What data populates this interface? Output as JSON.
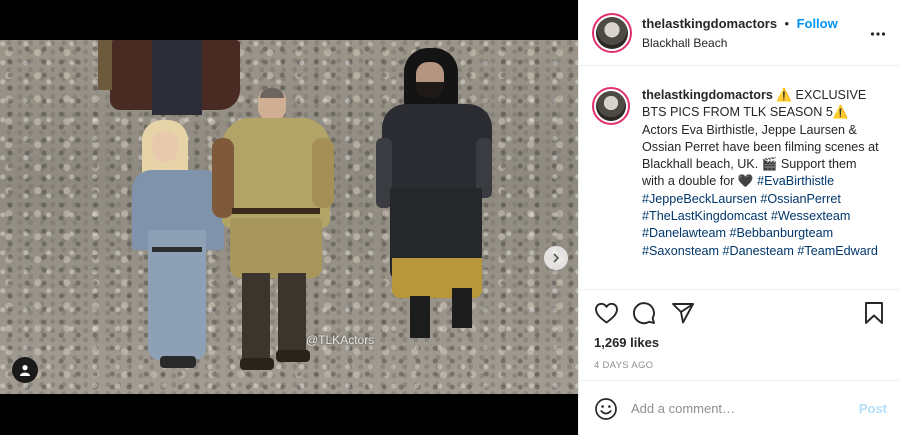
{
  "post": {
    "photo_watermark": "@TLKActors",
    "likes": "1,269 likes",
    "age": "4 DAYS AGO"
  },
  "header": {
    "username": "thelastkingdomactors",
    "separator": "•",
    "follow_label": "Follow",
    "location": "Blackhall Beach"
  },
  "caption": {
    "username": "thelastkingdomactors",
    "text_1": " ⚠️ EXCLUSIVE BTS PICS FROM TLK SEASON 5⚠️ Actors Eva Birthistle, Jeppe Laursen & Ossian Perret have been filming scenes at Blackhall beach, UK. 🎬 Support them with a double for 🖤 ",
    "hashtags": [
      "#EvaBirthistle",
      "#JeppeBeckLaursen",
      "#OssianPerret",
      "#TheLastKingdomcast",
      "#Wessexteam",
      "#Danelawteam",
      "#Bebbanburgteam",
      "#Saxonsteam",
      "#Danesteam",
      "#TeamEdward"
    ]
  },
  "comment": {
    "placeholder": "Add a comment…",
    "post_label": "Post"
  },
  "icons": {
    "more": "more-options-icon",
    "like": "heart-icon",
    "comment": "comment-icon",
    "share": "send-icon",
    "save": "bookmark-icon",
    "emoji": "emoji-icon",
    "next": "chevron-right-icon",
    "tags": "user-tag-icon"
  },
  "colors": {
    "accent": "#0095f6",
    "hashtag": "#00376b",
    "post_disabled": "#b2dffc"
  }
}
